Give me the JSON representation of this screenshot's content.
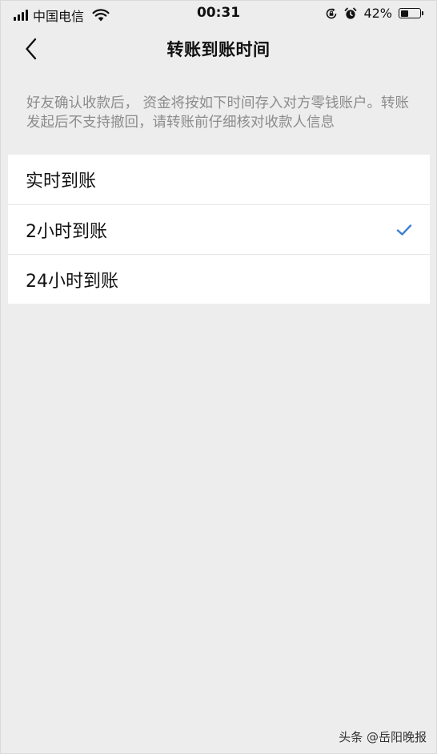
{
  "status_bar": {
    "carrier": "中国电信",
    "time": "00:31",
    "battery_percent": "42%",
    "battery_level": 0.42,
    "icons": [
      "signal-icon",
      "wifi-icon",
      "rotation-lock-icon",
      "alarm-icon",
      "battery-icon"
    ]
  },
  "nav": {
    "back_icon": "chevron-left-icon",
    "title": "转账到账时间"
  },
  "description": "好友确认收款后， 资金将按如下时间存入对方零钱账户。转账发起后不支持撤回，请转账前仔细核对收款人信息",
  "options": [
    {
      "label": "实时到账",
      "selected": false
    },
    {
      "label": "2小时到账",
      "selected": true
    },
    {
      "label": "24小时到账",
      "selected": false
    }
  ],
  "colors": {
    "background": "#ededed",
    "card": "#ffffff",
    "check": "#3f7fd6",
    "description_text": "#8c8c8c"
  },
  "watermark": "头条 @岳阳晚报"
}
